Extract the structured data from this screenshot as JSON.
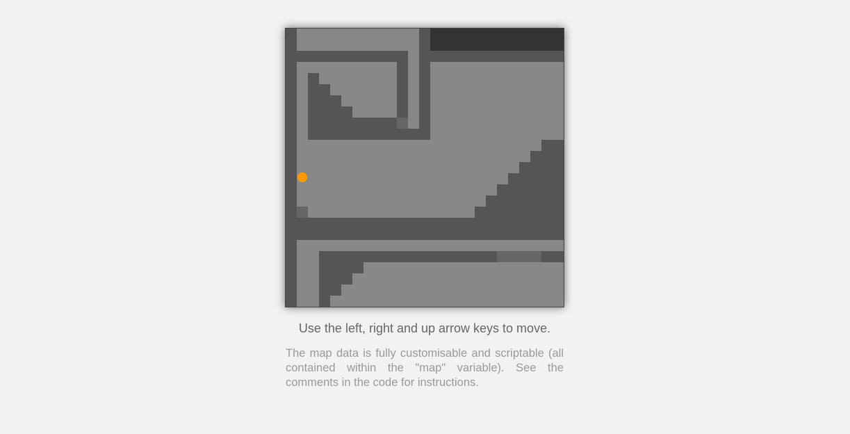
{
  "game": {
    "instructions": "Use the left, right and up arrow keys to move.",
    "description": "The map data is fully customisable and scriptable (all contained within the \"map\" variable). See the comments in the code for instructions.",
    "colors": {
      "page_background": "#f2f2f2",
      "floor": "#888888",
      "wall": "#555555",
      "wall_dark": "#333333",
      "special_tile": "#666666",
      "player": "#ff9900"
    },
    "map": {
      "tile_legend": {
        "0": "floor",
        "1": "wall",
        "2": "wall-dark",
        "3": "special-tile"
      },
      "rows": [
        "1000000000001222222222222",
        "1000000000001222222222222",
        "1111111111101111111111111",
        "1000000000101000000000000",
        "1010000000101000000000000",
        "1011000000101000000000000",
        "1011100000101000000000000",
        "1011110000101000000000000",
        "1011111111301000000000000",
        "1011111111111000000000000",
        "1000000000000000000000011",
        "1000000000000000000000111",
        "1000000000000000000001111",
        "1000000000000000000011111",
        "1000000000000000000111111",
        "1000000000000000001111111",
        "1300000000000000011111111",
        "1111111111111111111111111",
        "1111111111111111111111111",
        "1000000000000000000000000",
        "1001111111111111111333311",
        "1001111000000000000000000",
        "1001110000000000000000000",
        "1001100000000000000000000",
        "1001000000000000000000000",
        "1001000000000000000000000",
        "1000000000000000000000000"
      ]
    },
    "player": {
      "col": 1.5,
      "row": 13.5
    }
  }
}
